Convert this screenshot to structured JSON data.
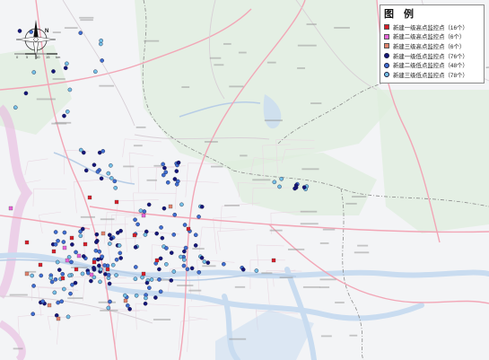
{
  "legend": {
    "title": "图 例",
    "items": [
      {
        "label": "新建一级高点监控点（16个）",
        "shape": "square",
        "color": "#d61e2a"
      },
      {
        "label": "新建二级高点监控点（6个）",
        "shape": "square",
        "color": "#e864d8"
      },
      {
        "label": "新建三级高点监控点（6个）",
        "shape": "square",
        "color": "#e0826c"
      },
      {
        "label": "新建一级低点监控点（76个）",
        "shape": "dot",
        "color": "#14167a"
      },
      {
        "label": "新建二级低点监控点（48个）",
        "shape": "dot",
        "color": "#3f6fd2"
      },
      {
        "label": "新建三级低点监控点（78个）",
        "shape": "dot",
        "color": "#74c0e6"
      }
    ]
  },
  "north_arrow": {
    "label": "N"
  },
  "scale_bar": {
    "ticks": [
      "0",
      "5",
      "10",
      "15",
      "km"
    ]
  },
  "colors": {
    "background": "#f3f4f6",
    "water": "#c9dcf0",
    "river_line": "#b7cde6",
    "green_area": "#dfeede",
    "pink_boundary": "#e7b7df",
    "road_highway": "#f2a6b6",
    "road_minor": "#d8cfd6",
    "admin_boundary": "#8a8a8a",
    "urban_grid": "#e9d8e2",
    "label_gray": "#9a9a9a"
  }
}
